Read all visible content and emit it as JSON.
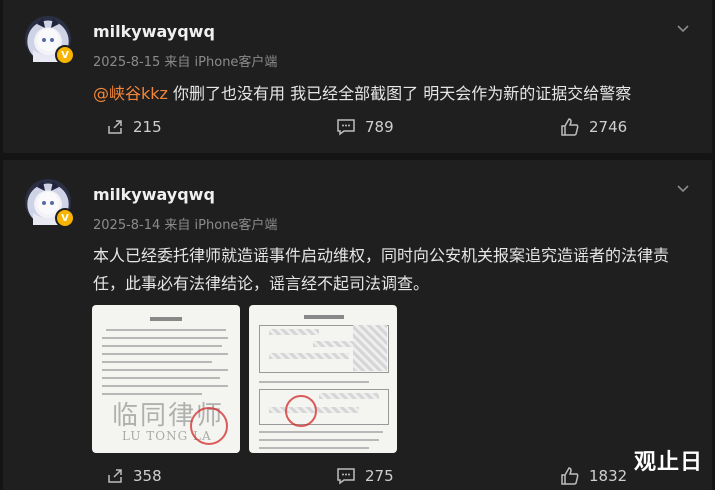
{
  "posts": [
    {
      "username": "milkywayqwq",
      "meta": "2025-8-15 来自 iPhone客户端",
      "mention": "@峡谷kkz",
      "text": " 你删了也没有用 我已经全部截图了 明天会作为新的证据交给警察",
      "reposts": "215",
      "comments": "789",
      "likes": "2746"
    },
    {
      "username": "milkywayqwq",
      "meta": "2025-8-14 来自 iPhone客户端",
      "text": "本人已经委托律师就造谣事件启动维权，同时向公安机关报案追究造谣者的法律责任，此事必有法律结论，谣言经不起司法调查。",
      "images": [
        {
          "title": "律师函",
          "watermark": "临同律师",
          "watermark_en": "LU TONG LA"
        },
        {
          "title": "报案回执"
        }
      ],
      "reposts": "358",
      "comments": "275",
      "likes": "1832"
    }
  ],
  "corner_watermark": "观止日",
  "icons": {
    "avatar_badge": "V",
    "more": "chevron-down-icon",
    "repost": "share-icon",
    "comment": "comment-icon",
    "like": "thumbs-up-icon"
  },
  "colors": {
    "mention": "#f2863a",
    "badge": "#f7b500"
  }
}
